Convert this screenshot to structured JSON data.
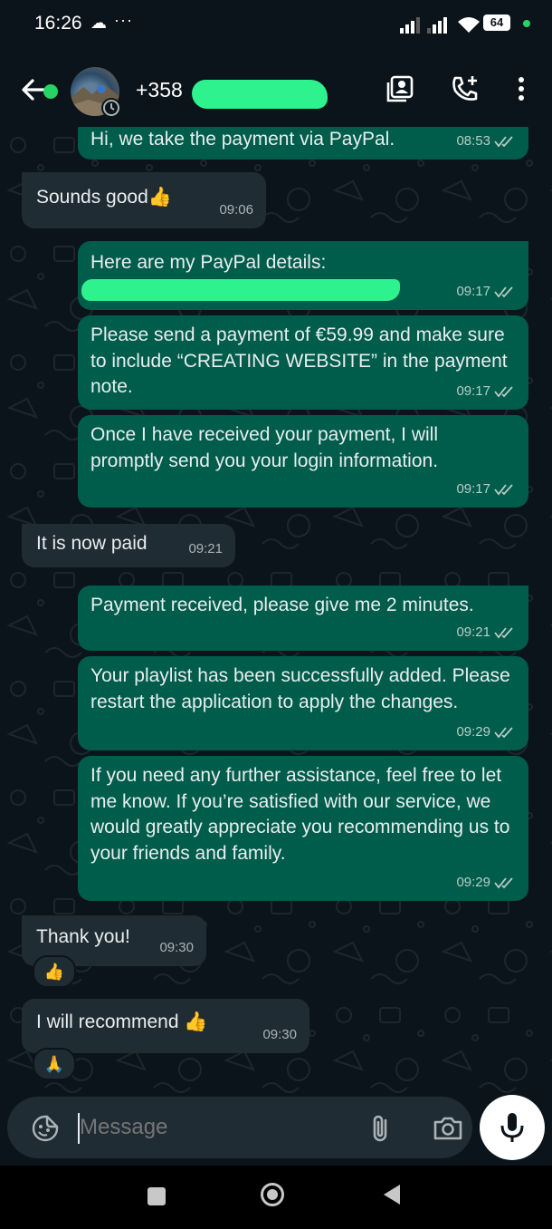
{
  "status_bar": {
    "time": "16:26",
    "dots": "···",
    "battery": "64",
    "icons": [
      "cloud-icon",
      "signal-icon",
      "wifi-icon",
      "battery-icon"
    ]
  },
  "header": {
    "contact": "+358",
    "icons": [
      "back-arrow-icon",
      "contact-card-icon",
      "add-call-icon",
      "more-vert-icon"
    ]
  },
  "messages": [
    {
      "dir": "out",
      "text": "Hi, we take the payment via PayPal.",
      "time": "08:53"
    },
    {
      "dir": "in",
      "text": "Sounds good👍",
      "time": "09:06"
    },
    {
      "dir": "out",
      "text": "Here are my PayPal details:",
      "time": "09:17"
    },
    {
      "dir": "out",
      "text": "Please send a payment of €59.99 and make sure to include “CREATING WEBSITE” in the payment note.",
      "time": "09:17"
    },
    {
      "dir": "out",
      "text": "Once I have received your payment, I will promptly send you your login information.",
      "time": "09:17"
    },
    {
      "dir": "in",
      "text": "It is now paid",
      "time": "09:21"
    },
    {
      "dir": "out",
      "text": "Payment received, please give me 2 minutes.",
      "time": "09:21"
    },
    {
      "dir": "out",
      "text": "Your playlist has been successfully added. Please restart the application to apply the changes.",
      "time": "09:29"
    },
    {
      "dir": "out",
      "text": "If you need any further assistance, feel free to let me know. If you’re satisfied with our service, we would greatly appreciate you recommending us to your friends and family.",
      "time": "09:29"
    },
    {
      "dir": "in",
      "text": "Thank you!",
      "time": "09:30",
      "reaction": "👍"
    },
    {
      "dir": "in",
      "text": "I will recommend 👍",
      "time": "09:30",
      "reaction": "🙏"
    }
  ],
  "composer": {
    "placeholder": "Message",
    "icons": [
      "emoji-sticker-icon",
      "attach-icon",
      "camera-icon",
      "mic-icon"
    ]
  },
  "colors": {
    "background": "#0b141a",
    "outgoing_bubble": "#005c4b",
    "incoming_bubble": "#202c33",
    "accent": "#25d366",
    "redaction": "#2ef28e"
  }
}
